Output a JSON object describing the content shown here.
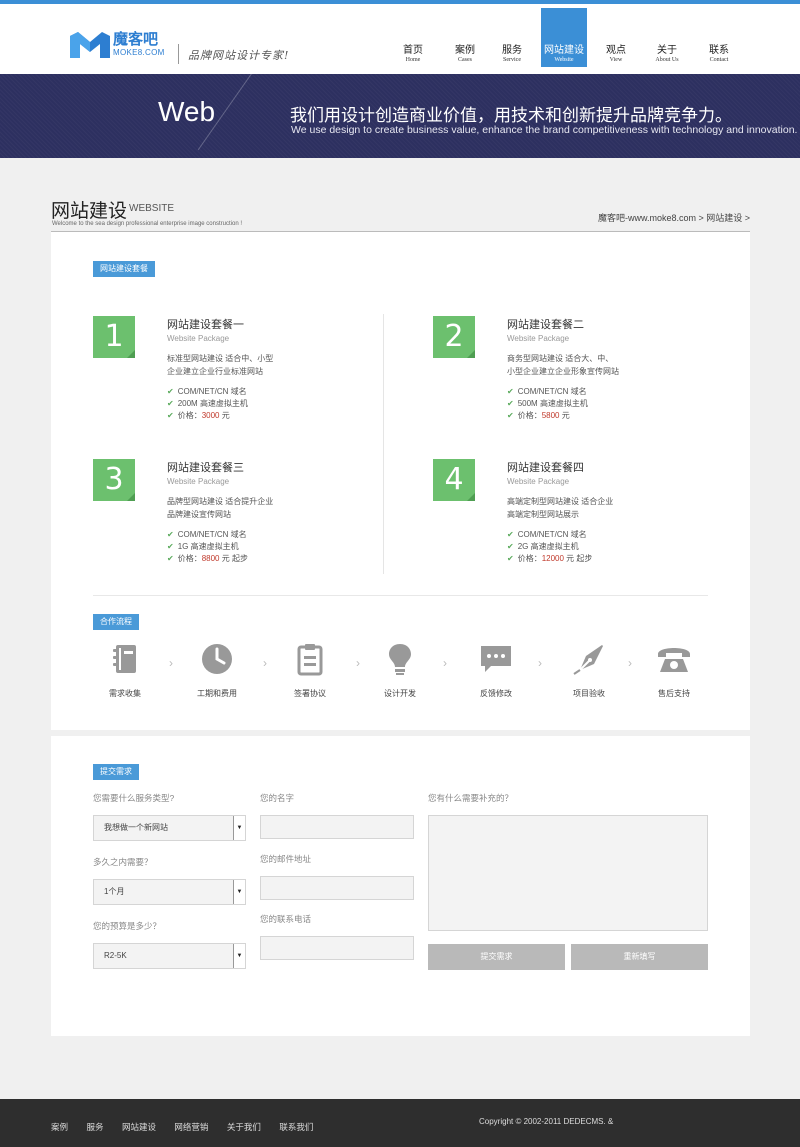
{
  "header": {
    "logo_cn": "魔客吧",
    "logo_en": "MOKE8.COM",
    "slogan": "品牌网站设计专家!",
    "nav": [
      {
        "cn": "首页",
        "en": "Home"
      },
      {
        "cn": "案例",
        "en": "Cases"
      },
      {
        "cn": "服务",
        "en": "Service"
      },
      {
        "cn": "网站建设",
        "en": "Website"
      },
      {
        "cn": "观点",
        "en": "View"
      },
      {
        "cn": "关于",
        "en": "About Us"
      },
      {
        "cn": "联系",
        "en": "Contact"
      }
    ],
    "active_index": 3
  },
  "banner": {
    "title": "Web",
    "headline": "我们用设计创造商业价值，用技术和创新提升品牌竞争力。",
    "subline": "We use design to create business value, enhance the brand competitiveness with technology and innovation."
  },
  "section": {
    "title": "网站建设",
    "title_en": "WEBSITE",
    "subtitle": "Welcome to the sea design professional enterprise image construction !",
    "breadcrumb": "魔客吧-www.moke8.com > 网站建设 >"
  },
  "packages_tag": "网站建设套餐",
  "packages": [
    {
      "num": "1",
      "title": "网站建设套餐一",
      "sub": "Website Package",
      "desc": [
        "标准型网站建设 适合中、小型",
        "企业建立企业行业标准网站"
      ],
      "f1": "COM/NET/CN 域名",
      "f2": "200M 高速虚拟主机",
      "price_label": "价格：",
      "price": "3000",
      "price_suffix": " 元"
    },
    {
      "num": "2",
      "title": "网站建设套餐二",
      "sub": "Website Package",
      "desc": [
        "商务型网站建设 适合大、中、",
        "小型企业建立企业形象宣传网站"
      ],
      "f1": "COM/NET/CN 域名",
      "f2": "500M 高速虚拟主机",
      "price_label": "价格：",
      "price": "5800",
      "price_suffix": " 元"
    },
    {
      "num": "3",
      "title": "网站建设套餐三",
      "sub": "Website Package",
      "desc": [
        "品牌型网站建设 适合提升企业",
        "品牌建设宣传网站"
      ],
      "f1": "COM/NET/CN 域名",
      "f2": "1G 高速虚拟主机",
      "price_label": "价格：",
      "price": "8800",
      "price_suffix": " 元 起步"
    },
    {
      "num": "4",
      "title": "网站建设套餐四",
      "sub": "Website Package",
      "desc": [
        "高端定制型网站建设 适合企业",
        "高端定制型网站展示"
      ],
      "f1": "COM/NET/CN 域名",
      "f2": "2G 高速虚拟主机",
      "price_label": "价格：",
      "price": "12000",
      "price_suffix": " 元 起步"
    }
  ],
  "process_tag": "合作流程",
  "process": [
    {
      "label": "需求收集",
      "icon": "notebook-icon"
    },
    {
      "label": "工期和费用",
      "icon": "clock-icon"
    },
    {
      "label": "签署协议",
      "icon": "clipboard-icon"
    },
    {
      "label": "设计开发",
      "icon": "lightbulb-icon"
    },
    {
      "label": "反馈修改",
      "icon": "chat-bubble-icon"
    },
    {
      "label": "项目验收",
      "icon": "pen-nib-icon"
    },
    {
      "label": "售后支持",
      "icon": "telephone-icon"
    }
  ],
  "form": {
    "tag": "提交需求",
    "q_service": "您需要什么服务类型?",
    "service_value": "我想做一个新网站",
    "q_time": "多久之内需要？",
    "time_value": "1个月",
    "q_budget": "您的预算是多少？",
    "budget_value": "R2-5K",
    "name_label": "您的名字",
    "email_label": "您的邮件地址",
    "phone_label": "您的联系电话",
    "extra_label": "您有什么需要补充的？",
    "submit_label": "提交需求",
    "reset_label": "重新填写"
  },
  "footer": {
    "links": [
      "案例",
      "服务",
      "网站建设",
      "网络营销",
      "关于我们",
      "联系我们"
    ],
    "copyright": "Copyright © 2002-2011 DEDECMS. &"
  },
  "colors": {
    "accent": "#3b8fd6",
    "banner": "#2d3060",
    "package_green": "#6cc06e",
    "price": "#c0392b",
    "footer": "#2e2e2e"
  }
}
